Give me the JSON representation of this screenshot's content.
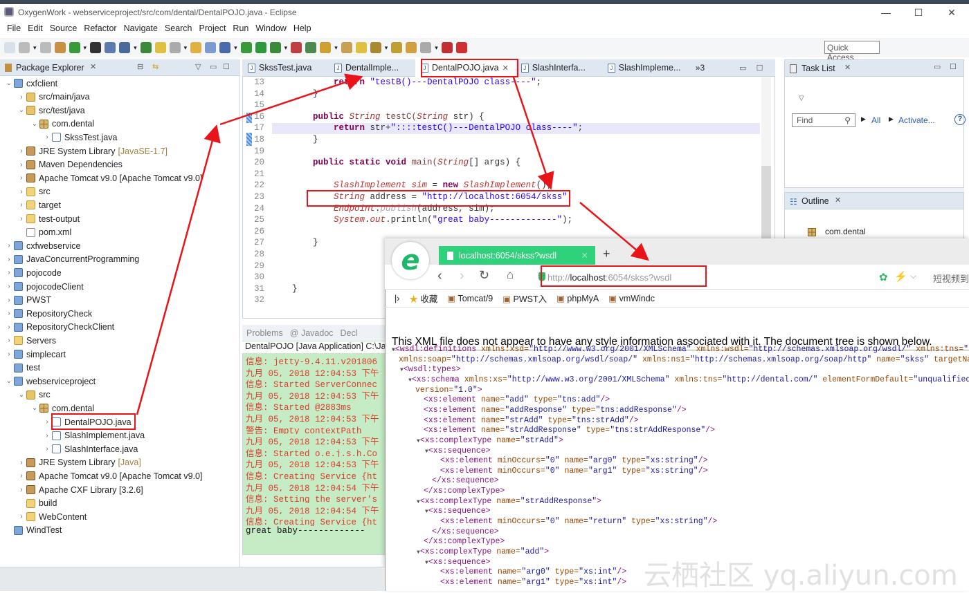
{
  "window": {
    "title": "OxygenWork - webserviceproject/src/com/dental/DentalPOJO.java - Eclipse",
    "minimize": "—",
    "maximize": "☐",
    "close": "✕"
  },
  "menu": [
    "File",
    "Edit",
    "Source",
    "Refactor",
    "Navigate",
    "Search",
    "Project",
    "Run",
    "Window",
    "Help"
  ],
  "toolbar": {
    "quick_access": "Quick Access"
  },
  "package_explorer": {
    "title": "Package Explorer",
    "tree": [
      {
        "level": 0,
        "exp": "v",
        "icon": "proj",
        "label": "cxfclient"
      },
      {
        "level": 1,
        "exp": ">",
        "icon": "pkgfold",
        "label": "src/main/java"
      },
      {
        "level": 1,
        "exp": "v",
        "icon": "pkgfold",
        "label": "src/test/java"
      },
      {
        "level": 2,
        "exp": "v",
        "icon": "pkg",
        "label": "com.dental"
      },
      {
        "level": 3,
        "exp": ">",
        "icon": "java",
        "label": "SkssTest.java"
      },
      {
        "level": 1,
        "exp": ">",
        "icon": "lib",
        "label": "JRE System Library",
        "deco": "[JavaSE-1.7]"
      },
      {
        "level": 1,
        "exp": ">",
        "icon": "lib",
        "label": "Maven Dependencies"
      },
      {
        "level": 1,
        "exp": ">",
        "icon": "lib",
        "label": "Apache Tomcat v9.0 [Apache Tomcat v9.0]"
      },
      {
        "level": 1,
        "exp": ">",
        "icon": "folder",
        "label": "src"
      },
      {
        "level": 1,
        "exp": ">",
        "icon": "folder",
        "label": "target"
      },
      {
        "level": 1,
        "exp": ">",
        "icon": "folder",
        "label": "test-output"
      },
      {
        "level": 1,
        "exp": "",
        "icon": "file",
        "label": "pom.xml"
      },
      {
        "level": 0,
        "exp": ">",
        "icon": "proj",
        "label": "cxfwebservice"
      },
      {
        "level": 0,
        "exp": ">",
        "icon": "proj",
        "label": "JavaConcurrentProgramming"
      },
      {
        "level": 0,
        "exp": ">",
        "icon": "proj",
        "label": "pojocode"
      },
      {
        "level": 0,
        "exp": ">",
        "icon": "proj",
        "label": "pojocodeClient"
      },
      {
        "level": 0,
        "exp": ">",
        "icon": "proj",
        "label": "PWST"
      },
      {
        "level": 0,
        "exp": ">",
        "icon": "proj",
        "label": "RepositoryCheck"
      },
      {
        "level": 0,
        "exp": ">",
        "icon": "proj",
        "label": "RepositoryCheckClient"
      },
      {
        "level": 0,
        "exp": ">",
        "icon": "folder",
        "label": "Servers"
      },
      {
        "level": 0,
        "exp": ">",
        "icon": "proj",
        "label": "simplecart"
      },
      {
        "level": 0,
        "exp": "",
        "icon": "proj",
        "label": "test"
      },
      {
        "level": 0,
        "exp": "v",
        "icon": "proj",
        "label": "webserviceproject"
      },
      {
        "level": 1,
        "exp": "v",
        "icon": "pkgfold",
        "label": "src"
      },
      {
        "level": 2,
        "exp": "v",
        "icon": "pkg",
        "label": "com.dental"
      },
      {
        "level": 3,
        "exp": ">",
        "icon": "java",
        "label": "DentalPOJO.java",
        "selected": true
      },
      {
        "level": 3,
        "exp": ">",
        "icon": "java",
        "label": "SlashImplement.java"
      },
      {
        "level": 3,
        "exp": ">",
        "icon": "java",
        "label": "SlashInterface.java"
      },
      {
        "level": 1,
        "exp": ">",
        "icon": "lib",
        "label": "JRE System Library",
        "deco": "[Java]"
      },
      {
        "level": 1,
        "exp": ">",
        "icon": "lib",
        "label": "Apache Tomcat v9.0 [Apache Tomcat v9.0]"
      },
      {
        "level": 1,
        "exp": ">",
        "icon": "lib",
        "label": "Apache CXF Library [3.2.6]"
      },
      {
        "level": 1,
        "exp": "",
        "icon": "folder",
        "label": "build"
      },
      {
        "level": 1,
        "exp": ">",
        "icon": "folder",
        "label": "WebContent"
      },
      {
        "level": 0,
        "exp": "",
        "icon": "proj",
        "label": "WindTest"
      }
    ]
  },
  "editor": {
    "tabs": [
      {
        "label": "SkssTest.java"
      },
      {
        "label": "DentalImple..."
      },
      {
        "label": "DentalPOJO.java",
        "active": true
      },
      {
        "label": "SlashInterfa..."
      },
      {
        "label": "SlashImpleme..."
      }
    ],
    "overflow": "»3",
    "lines": [
      {
        "n": "13",
        "s": [
          [
            "pl",
            "        "
          ],
          [
            "kw",
            "return "
          ],
          [
            "str",
            "\"testB()---DentalPOJO class----\""
          ],
          [
            "pl",
            ";"
          ]
        ]
      },
      {
        "n": "14",
        "s": [
          [
            "pl",
            "    }"
          ]
        ]
      },
      {
        "n": "15",
        "s": []
      },
      {
        "n": "16",
        "s": [
          [
            "pl",
            "    "
          ],
          [
            "kw",
            "public "
          ],
          [
            "ty",
            "String "
          ],
          [
            "fn",
            "testC("
          ],
          [
            "ty",
            "String "
          ],
          [
            "pl",
            "str) {"
          ]
        ]
      },
      {
        "n": "17",
        "s": [
          [
            "pl",
            "        "
          ],
          [
            "kw",
            "return "
          ],
          [
            "pl",
            "str+"
          ],
          [
            "str",
            "\"::::testC()---DentalPOJO class----\""
          ],
          [
            "pl",
            ";"
          ]
        ],
        "hl": true
      },
      {
        "n": "18",
        "s": [
          [
            "pl",
            "    }"
          ]
        ]
      },
      {
        "n": "19",
        "s": []
      },
      {
        "n": "20",
        "s": [
          [
            "pl",
            "    "
          ],
          [
            "kw",
            "public static void "
          ],
          [
            "fn",
            "main("
          ],
          [
            "ty",
            "String"
          ],
          [
            "pl",
            "[] args) {"
          ]
        ]
      },
      {
        "n": "21",
        "s": []
      },
      {
        "n": "22",
        "s": [
          [
            "pl",
            "        "
          ],
          [
            "it",
            "SlashImplement sim "
          ],
          [
            "pl",
            "= "
          ],
          [
            "kw",
            "new "
          ],
          [
            "it",
            "SlashImplement"
          ],
          [
            "pl",
            "();"
          ]
        ]
      },
      {
        "n": "23",
        "s": [
          [
            "pl",
            "        "
          ],
          [
            "ty",
            "String "
          ],
          [
            "pl",
            "address = "
          ],
          [
            "str",
            "\"http://localhost:6054/skss\""
          ],
          [
            "pl",
            ";"
          ]
        ]
      },
      {
        "n": "24",
        "s": [
          [
            "pl",
            "        "
          ],
          [
            "it",
            "Endpoint"
          ],
          [
            "pl",
            "."
          ],
          [
            "dim",
            "publish"
          ],
          [
            "pl",
            "(address, sim);"
          ]
        ]
      },
      {
        "n": "25",
        "s": [
          [
            "pl",
            "        "
          ],
          [
            "it",
            "System"
          ],
          [
            "pl",
            "."
          ],
          [
            "it",
            "out"
          ],
          [
            "pl",
            ".println("
          ],
          [
            "str",
            "\"great baby-------------\""
          ],
          [
            "pl",
            ");"
          ]
        ]
      },
      {
        "n": "26",
        "s": []
      },
      {
        "n": "27",
        "s": [
          [
            "pl",
            "    }"
          ]
        ]
      },
      {
        "n": "28",
        "s": []
      },
      {
        "n": "29",
        "s": []
      },
      {
        "n": "30",
        "s": []
      },
      {
        "n": "31",
        "s": [
          [
            "pl",
            "}"
          ]
        ]
      },
      {
        "n": "32",
        "s": []
      }
    ]
  },
  "console": {
    "tabs": [
      "Problems",
      "@ Javadoc",
      "Decl"
    ],
    "title": "DentalPOJO [Java Application] C:\\Ja",
    "lines": [
      "信息: jetty-9.4.11.v201806",
      "九月 05, 2018 12:04:53 下午",
      "信息: Started ServerConnec",
      "九月 05, 2018 12:04:53 下午",
      "信息: Started @2883ms",
      "九月 05, 2018 12:04:53 下午",
      "警告: Empty contextPath",
      "九月 05, 2018 12:04:53 下午",
      "信息: Started o.e.j.s.h.Co",
      "九月 05, 2018 12:04:53 下午",
      "信息: Creating Service {ht",
      "九月 05, 2018 12:04:54 下午",
      "信息: Setting the server's",
      "九月 05, 2018 12:04:54 下午",
      "信息: Creating Service {ht"
    ],
    "output": "great baby-------------"
  },
  "task_list": {
    "title": "Task List",
    "find_placeholder": "Find",
    "all": "All",
    "activate": "Activate...",
    "help": "?"
  },
  "outline": {
    "title": "Outline",
    "item": "com.dental"
  },
  "browser": {
    "tab_title": "localhost:6054/skss?wsdl",
    "new_tab": "+",
    "url_prefix": "http://",
    "url_host": "localhost",
    "url_rest": ":6054/skss?wsdl",
    "right_text": "短视频到",
    "bookmarks": [
      "收藏",
      "Tomcat/9",
      "PWST入",
      "phpMyA",
      "vmWindc"
    ],
    "message": "This XML file does not appear to have any style information associated with it. The document tree is shown below.",
    "xml": [
      {
        "i": 0,
        "tri": "▼",
        "s": [
          [
            "xt",
            "<wsdl:definitions "
          ],
          [
            "xa",
            "xmlns:xsd="
          ],
          [
            "xv",
            "\"http://www.w3.org/2001/XMLSchema\" "
          ],
          [
            "xa",
            "xmlns:wsdl="
          ],
          [
            "xv",
            "\"http://schemas.xmlsoap.org/wsdl/\" "
          ],
          [
            "xa",
            "xmlns:tns="
          ],
          [
            "xv",
            "\"h"
          ]
        ]
      },
      {
        "i": 0,
        "s": [
          [
            "xa",
            "xmlns:soap="
          ],
          [
            "xv",
            "\"http://schemas.xmlsoap.org/wsdl/soap/\" "
          ],
          [
            "xa",
            "xmlns:ns1="
          ],
          [
            "xv",
            "\"http://schemas.xmlsoap.org/soap/http\" "
          ],
          [
            "xa",
            "name="
          ],
          [
            "xv",
            "\"skss\" "
          ],
          [
            "xa",
            "targetNam"
          ]
        ]
      },
      {
        "i": 1,
        "tri": "▼",
        "s": [
          [
            "xt",
            "<wsdl:types>"
          ]
        ]
      },
      {
        "i": 2,
        "tri": "▼",
        "s": [
          [
            "xt",
            "<xs:schema "
          ],
          [
            "xa",
            "xmlns:xs="
          ],
          [
            "xv",
            "\"http://www.w3.org/2001/XMLSchema\" "
          ],
          [
            "xa",
            "xmlns:tns="
          ],
          [
            "xv",
            "\"http://dental.com/\" "
          ],
          [
            "xa",
            "elementFormDefault="
          ],
          [
            "xv",
            "\"unqualified"
          ]
        ]
      },
      {
        "i": 2,
        "s": [
          [
            "xa",
            "version="
          ],
          [
            "xv",
            "\"1.0\""
          ],
          [
            "xt",
            ">"
          ]
        ]
      },
      {
        "i": 3,
        "s": [
          [
            "xt",
            "<xs:element "
          ],
          [
            "xa",
            "name="
          ],
          [
            "xv",
            "\"add\" "
          ],
          [
            "xa",
            "type="
          ],
          [
            "xv",
            "\"tns:add\""
          ],
          [
            "xt",
            "/>"
          ]
        ]
      },
      {
        "i": 3,
        "s": [
          [
            "xt",
            "<xs:element "
          ],
          [
            "xa",
            "name="
          ],
          [
            "xv",
            "\"addResponse\" "
          ],
          [
            "xa",
            "type="
          ],
          [
            "xv",
            "\"tns:addResponse\""
          ],
          [
            "xt",
            "/>"
          ]
        ]
      },
      {
        "i": 3,
        "s": [
          [
            "xt",
            "<xs:element "
          ],
          [
            "xa",
            "name="
          ],
          [
            "xv",
            "\"strAdd\" "
          ],
          [
            "xa",
            "type="
          ],
          [
            "xv",
            "\"tns:strAdd\""
          ],
          [
            "xt",
            "/>"
          ]
        ]
      },
      {
        "i": 3,
        "s": [
          [
            "xt",
            "<xs:element "
          ],
          [
            "xa",
            "name="
          ],
          [
            "xv",
            "\"strAddResponse\" "
          ],
          [
            "xa",
            "type="
          ],
          [
            "xv",
            "\"tns:strAddResponse\""
          ],
          [
            "xt",
            "/>"
          ]
        ]
      },
      {
        "i": 3,
        "tri": "▼",
        "s": [
          [
            "xt",
            "<xs:complexType "
          ],
          [
            "xa",
            "name="
          ],
          [
            "xv",
            "\"strAdd\""
          ],
          [
            "xt",
            ">"
          ]
        ]
      },
      {
        "i": 4,
        "tri": "▼",
        "s": [
          [
            "xt",
            "<xs:sequence>"
          ]
        ]
      },
      {
        "i": 5,
        "s": [
          [
            "xt",
            "<xs:element "
          ],
          [
            "xa",
            "minOccurs="
          ],
          [
            "xv",
            "\"0\" "
          ],
          [
            "xa",
            "name="
          ],
          [
            "xv",
            "\"arg0\" "
          ],
          [
            "xa",
            "type="
          ],
          [
            "xv",
            "\"xs:string\""
          ],
          [
            "xt",
            "/>"
          ]
        ]
      },
      {
        "i": 5,
        "s": [
          [
            "xt",
            "<xs:element "
          ],
          [
            "xa",
            "minOccurs="
          ],
          [
            "xv",
            "\"0\" "
          ],
          [
            "xa",
            "name="
          ],
          [
            "xv",
            "\"arg1\" "
          ],
          [
            "xa",
            "type="
          ],
          [
            "xv",
            "\"xs:string\""
          ],
          [
            "xt",
            "/>"
          ]
        ]
      },
      {
        "i": 4,
        "s": [
          [
            "xt",
            "</xs:sequence>"
          ]
        ]
      },
      {
        "i": 3,
        "s": [
          [
            "xt",
            "</xs:complexType>"
          ]
        ]
      },
      {
        "i": 3,
        "tri": "▼",
        "s": [
          [
            "xt",
            "<xs:complexType "
          ],
          [
            "xa",
            "name="
          ],
          [
            "xv",
            "\"strAddResponse\""
          ],
          [
            "xt",
            ">"
          ]
        ]
      },
      {
        "i": 4,
        "tri": "▼",
        "s": [
          [
            "xt",
            "<xs:sequence>"
          ]
        ]
      },
      {
        "i": 5,
        "s": [
          [
            "xt",
            "<xs:element "
          ],
          [
            "xa",
            "minOccurs="
          ],
          [
            "xv",
            "\"0\" "
          ],
          [
            "xa",
            "name="
          ],
          [
            "xv",
            "\"return\" "
          ],
          [
            "xa",
            "type="
          ],
          [
            "xv",
            "\"xs:string\""
          ],
          [
            "xt",
            "/>"
          ]
        ]
      },
      {
        "i": 4,
        "s": [
          [
            "xt",
            "</xs:sequence>"
          ]
        ]
      },
      {
        "i": 3,
        "s": [
          [
            "xt",
            "</xs:complexType>"
          ]
        ]
      },
      {
        "i": 3,
        "tri": "▼",
        "s": [
          [
            "xt",
            "<xs:complexType "
          ],
          [
            "xa",
            "name="
          ],
          [
            "xv",
            "\"add\""
          ],
          [
            "xt",
            ">"
          ]
        ]
      },
      {
        "i": 4,
        "tri": "▼",
        "s": [
          [
            "xt",
            "<xs:sequence>"
          ]
        ]
      },
      {
        "i": 5,
        "s": [
          [
            "xt",
            "<xs:element "
          ],
          [
            "xa",
            "name="
          ],
          [
            "xv",
            "\"arg0\" "
          ],
          [
            "xa",
            "type="
          ],
          [
            "xv",
            "\"xs:int\""
          ],
          [
            "xt",
            "/>"
          ]
        ]
      },
      {
        "i": 5,
        "s": [
          [
            "xt",
            "<xs:element "
          ],
          [
            "xa",
            "name="
          ],
          [
            "xv",
            "\"arg1\" "
          ],
          [
            "xa",
            "type="
          ],
          [
            "xv",
            "\"xs:int\""
          ],
          [
            "xt",
            "/>"
          ]
        ]
      }
    ]
  },
  "watermark": "云栖社区 yq.aliyun.com",
  "colors": {
    "annotation_red": "#e8141a",
    "browser_tab": "#2fd27a",
    "console_bg": "#c5ecc5"
  }
}
